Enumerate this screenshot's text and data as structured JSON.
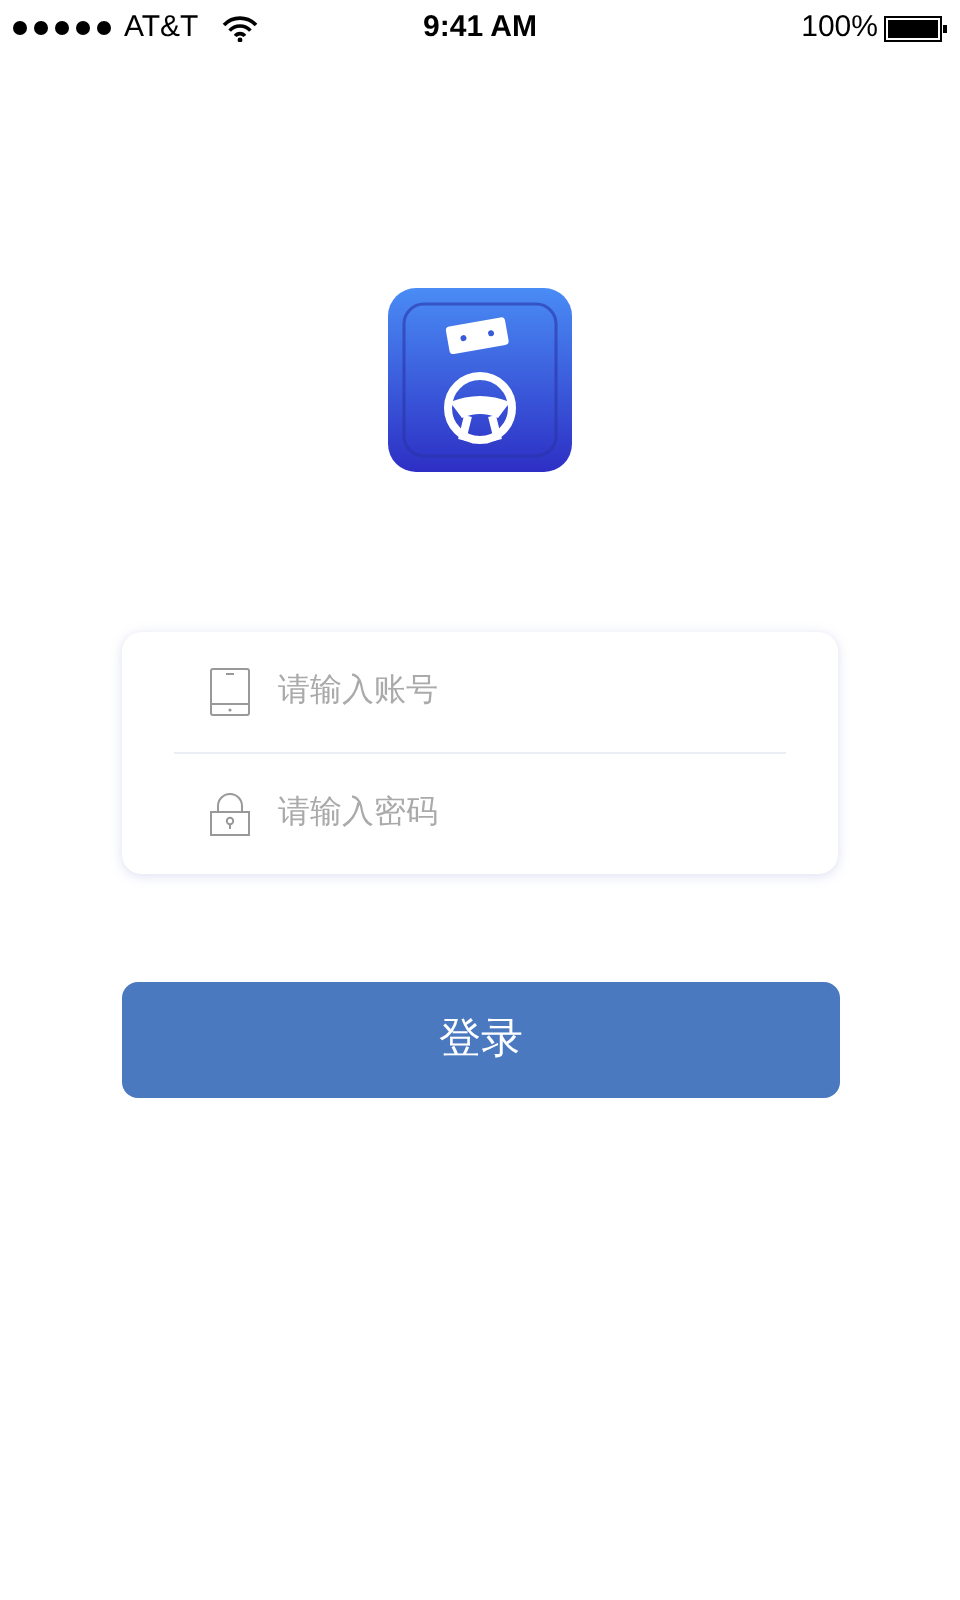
{
  "status_bar": {
    "carrier": "AT&T",
    "time": "9:41 AM",
    "battery": "100%"
  },
  "login_form": {
    "fields": [
      {
        "kind": "phone",
        "placeholder": "请输入账号"
      },
      {
        "kind": "lock",
        "placeholder": "请输入密码"
      }
    ]
  },
  "login_button": "登录"
}
